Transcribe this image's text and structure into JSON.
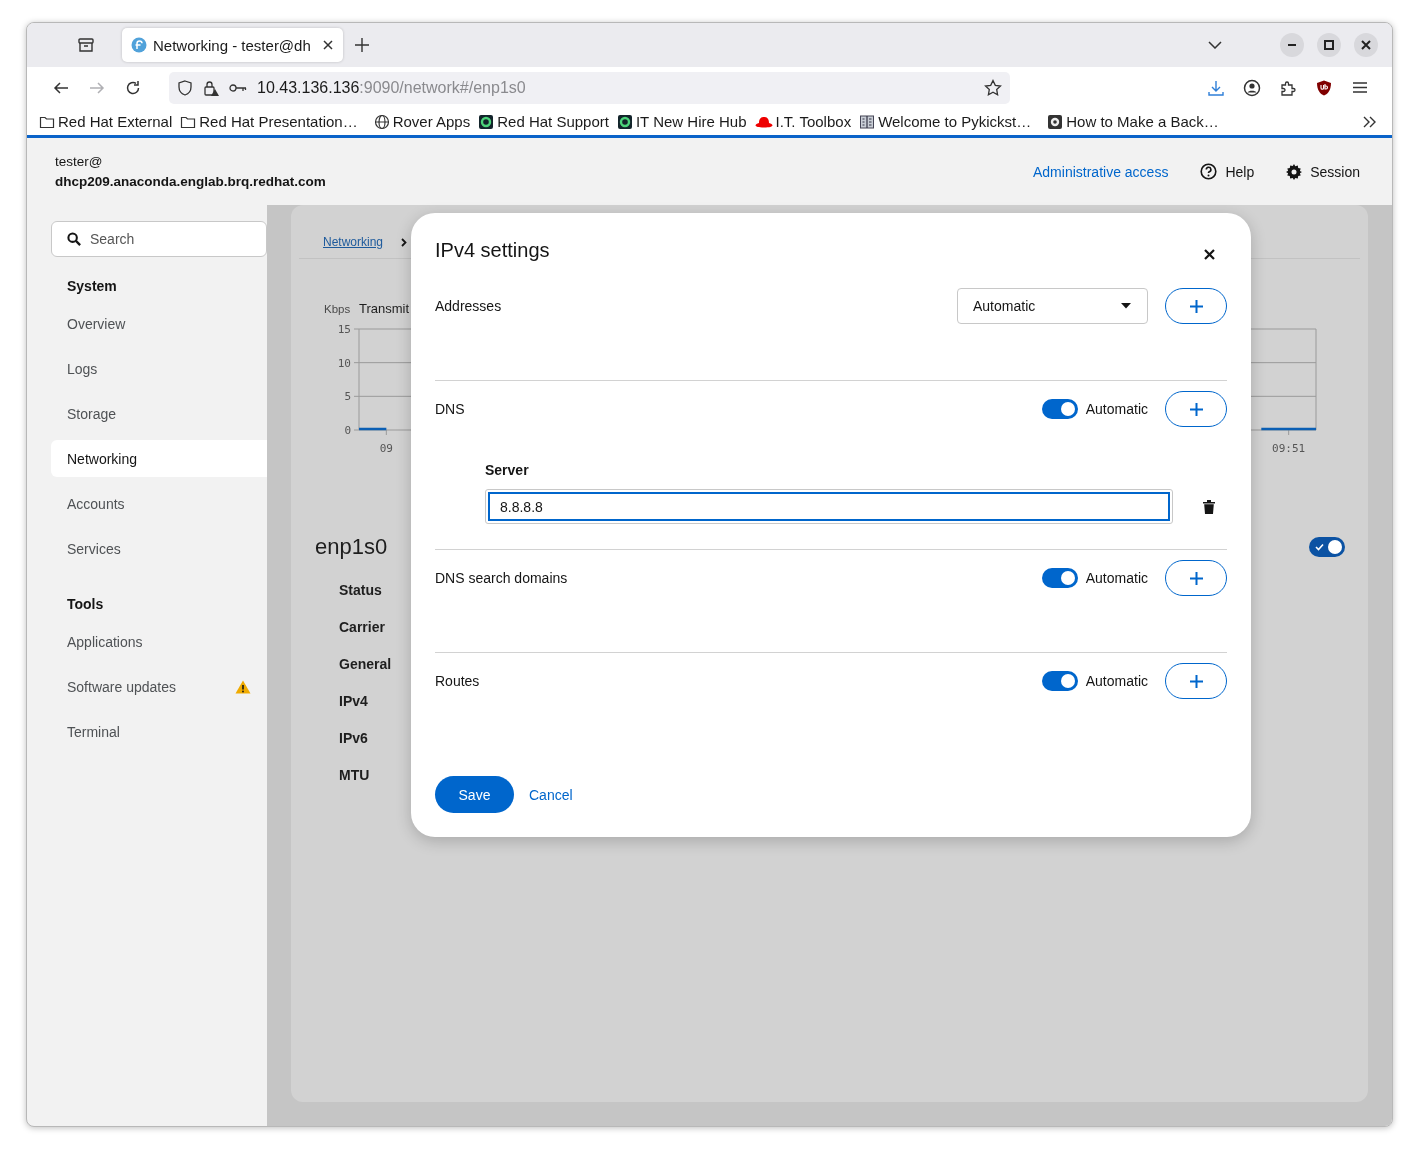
{
  "browser": {
    "tab": {
      "title": "Networking - tester@dh",
      "selected": true
    },
    "url_host": "10.43.136.136",
    "url_path": ":9090/network#/enp1s0",
    "bookmarks": [
      {
        "kind": "folder",
        "label": "Red Hat External"
      },
      {
        "kind": "folder",
        "label": "Red Hat Presentation…"
      },
      {
        "kind": "globe",
        "label": "Rover Apps"
      },
      {
        "kind": "ring",
        "label": "Red Hat Support"
      },
      {
        "kind": "ring",
        "label": "IT New Hire Hub"
      },
      {
        "kind": "hat",
        "label": "I.T. Toolbox"
      },
      {
        "kind": "book",
        "label": "Welcome to Pykickst…"
      },
      {
        "kind": "disc",
        "label": "How to Make a Back…"
      }
    ]
  },
  "header": {
    "user": "tester@",
    "host": "dhcp209.anaconda.englab.brq.redhat.com",
    "admin_link": "Administrative access",
    "help": "Help",
    "session": "Session"
  },
  "sidebar": {
    "search": {
      "placeholder": "Search"
    },
    "sections": [
      {
        "title": "System",
        "items": [
          {
            "label": "Overview",
            "selected": false,
            "warning": false
          },
          {
            "label": "Logs",
            "selected": false,
            "warning": false
          },
          {
            "label": "Storage",
            "selected": false,
            "warning": false
          },
          {
            "label": "Networking",
            "selected": true,
            "warning": false
          },
          {
            "label": "Accounts",
            "selected": false,
            "warning": false
          },
          {
            "label": "Services",
            "selected": false,
            "warning": false
          }
        ]
      },
      {
        "title": "Tools",
        "items": [
          {
            "label": "Applications",
            "selected": false,
            "warning": false
          },
          {
            "label": "Software updates",
            "selected": false,
            "warning": true
          },
          {
            "label": "Terminal",
            "selected": false,
            "warning": false
          }
        ]
      }
    ]
  },
  "page": {
    "breadcrumb": "Networking",
    "chart_data": {
      "type": "line",
      "title": "Transmit",
      "ylabel": "Kbps",
      "ylim": [
        0,
        15
      ],
      "yticks": [
        0,
        5,
        10,
        15
      ],
      "categories": [
        null,
        "09",
        null,
        null,
        null,
        null,
        null,
        null,
        null,
        null,
        null,
        null,
        null,
        null,
        null,
        null,
        null,
        null,
        null,
        null,
        null,
        null,
        null,
        null,
        null,
        null,
        null,
        null,
        null,
        null,
        null,
        null,
        null,
        null,
        "09:51",
        null
      ],
      "series": [
        {
          "color": "#0b5fb4",
          "values": [
            0,
            0,
            null,
            null,
            null,
            null,
            null,
            null,
            null,
            null,
            null,
            null,
            null,
            null,
            null,
            null,
            null,
            null,
            null,
            null,
            null,
            null,
            null,
            null,
            null,
            null,
            null,
            null,
            null,
            null,
            null,
            null,
            null,
            0,
            0,
            0
          ]
        }
      ]
    },
    "interface": {
      "name": "enp1s0",
      "on": true,
      "fields": [
        "Status",
        "Carrier",
        "General",
        "IPv4",
        "IPv6",
        "MTU"
      ]
    }
  },
  "dialog": {
    "title": "IPv4 settings",
    "sections": [
      {
        "kind": "select",
        "label": "Addresses",
        "value": "Automatic"
      },
      {
        "kind": "toggle",
        "label": "DNS",
        "on": true,
        "toggle_label": "Automatic",
        "entries": [
          {
            "label": "Server",
            "value": "8.8.8.8",
            "focused": true
          }
        ]
      },
      {
        "kind": "toggle",
        "label": "DNS search domains",
        "on": true,
        "toggle_label": "Automatic"
      },
      {
        "kind": "toggle",
        "label": "Routes",
        "on": true,
        "toggle_label": "Automatic"
      }
    ],
    "save": "Save",
    "cancel": "Cancel"
  }
}
